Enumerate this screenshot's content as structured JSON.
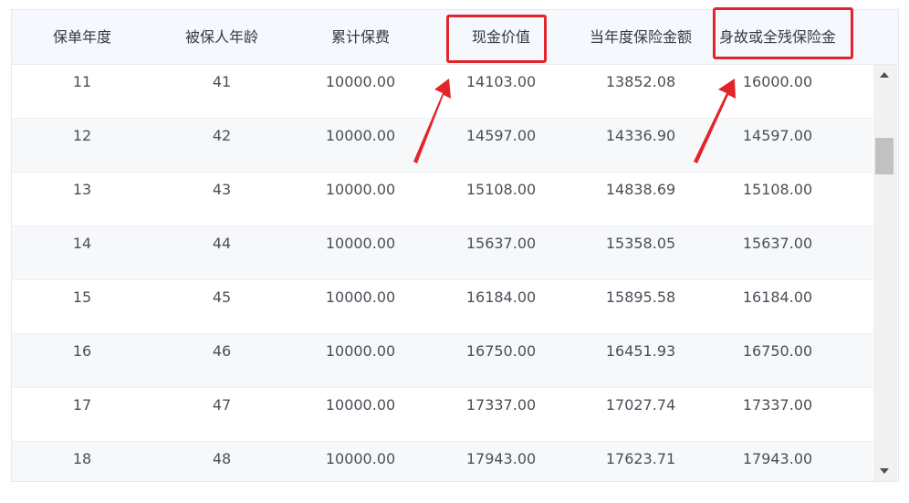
{
  "table": {
    "columns": [
      "保单年度",
      "被保人年龄",
      "累计保费",
      "现金价值",
      "当年度保险金额",
      "身故或全残保险金"
    ],
    "rows": [
      [
        "11",
        "41",
        "10000.00",
        "14103.00",
        "13852.08",
        "16000.00"
      ],
      [
        "12",
        "42",
        "10000.00",
        "14597.00",
        "14336.90",
        "14597.00"
      ],
      [
        "13",
        "43",
        "10000.00",
        "15108.00",
        "14838.69",
        "15108.00"
      ],
      [
        "14",
        "44",
        "10000.00",
        "15637.00",
        "15358.05",
        "15637.00"
      ],
      [
        "15",
        "45",
        "10000.00",
        "16184.00",
        "15895.58",
        "16184.00"
      ],
      [
        "16",
        "46",
        "10000.00",
        "16750.00",
        "16451.93",
        "16750.00"
      ],
      [
        "17",
        "47",
        "10000.00",
        "17337.00",
        "17027.74",
        "17337.00"
      ],
      [
        "18",
        "48",
        "10000.00",
        "17943.00",
        "17623.71",
        "17943.00"
      ]
    ]
  },
  "annotations": {
    "highlight_color": "#e3242b"
  }
}
